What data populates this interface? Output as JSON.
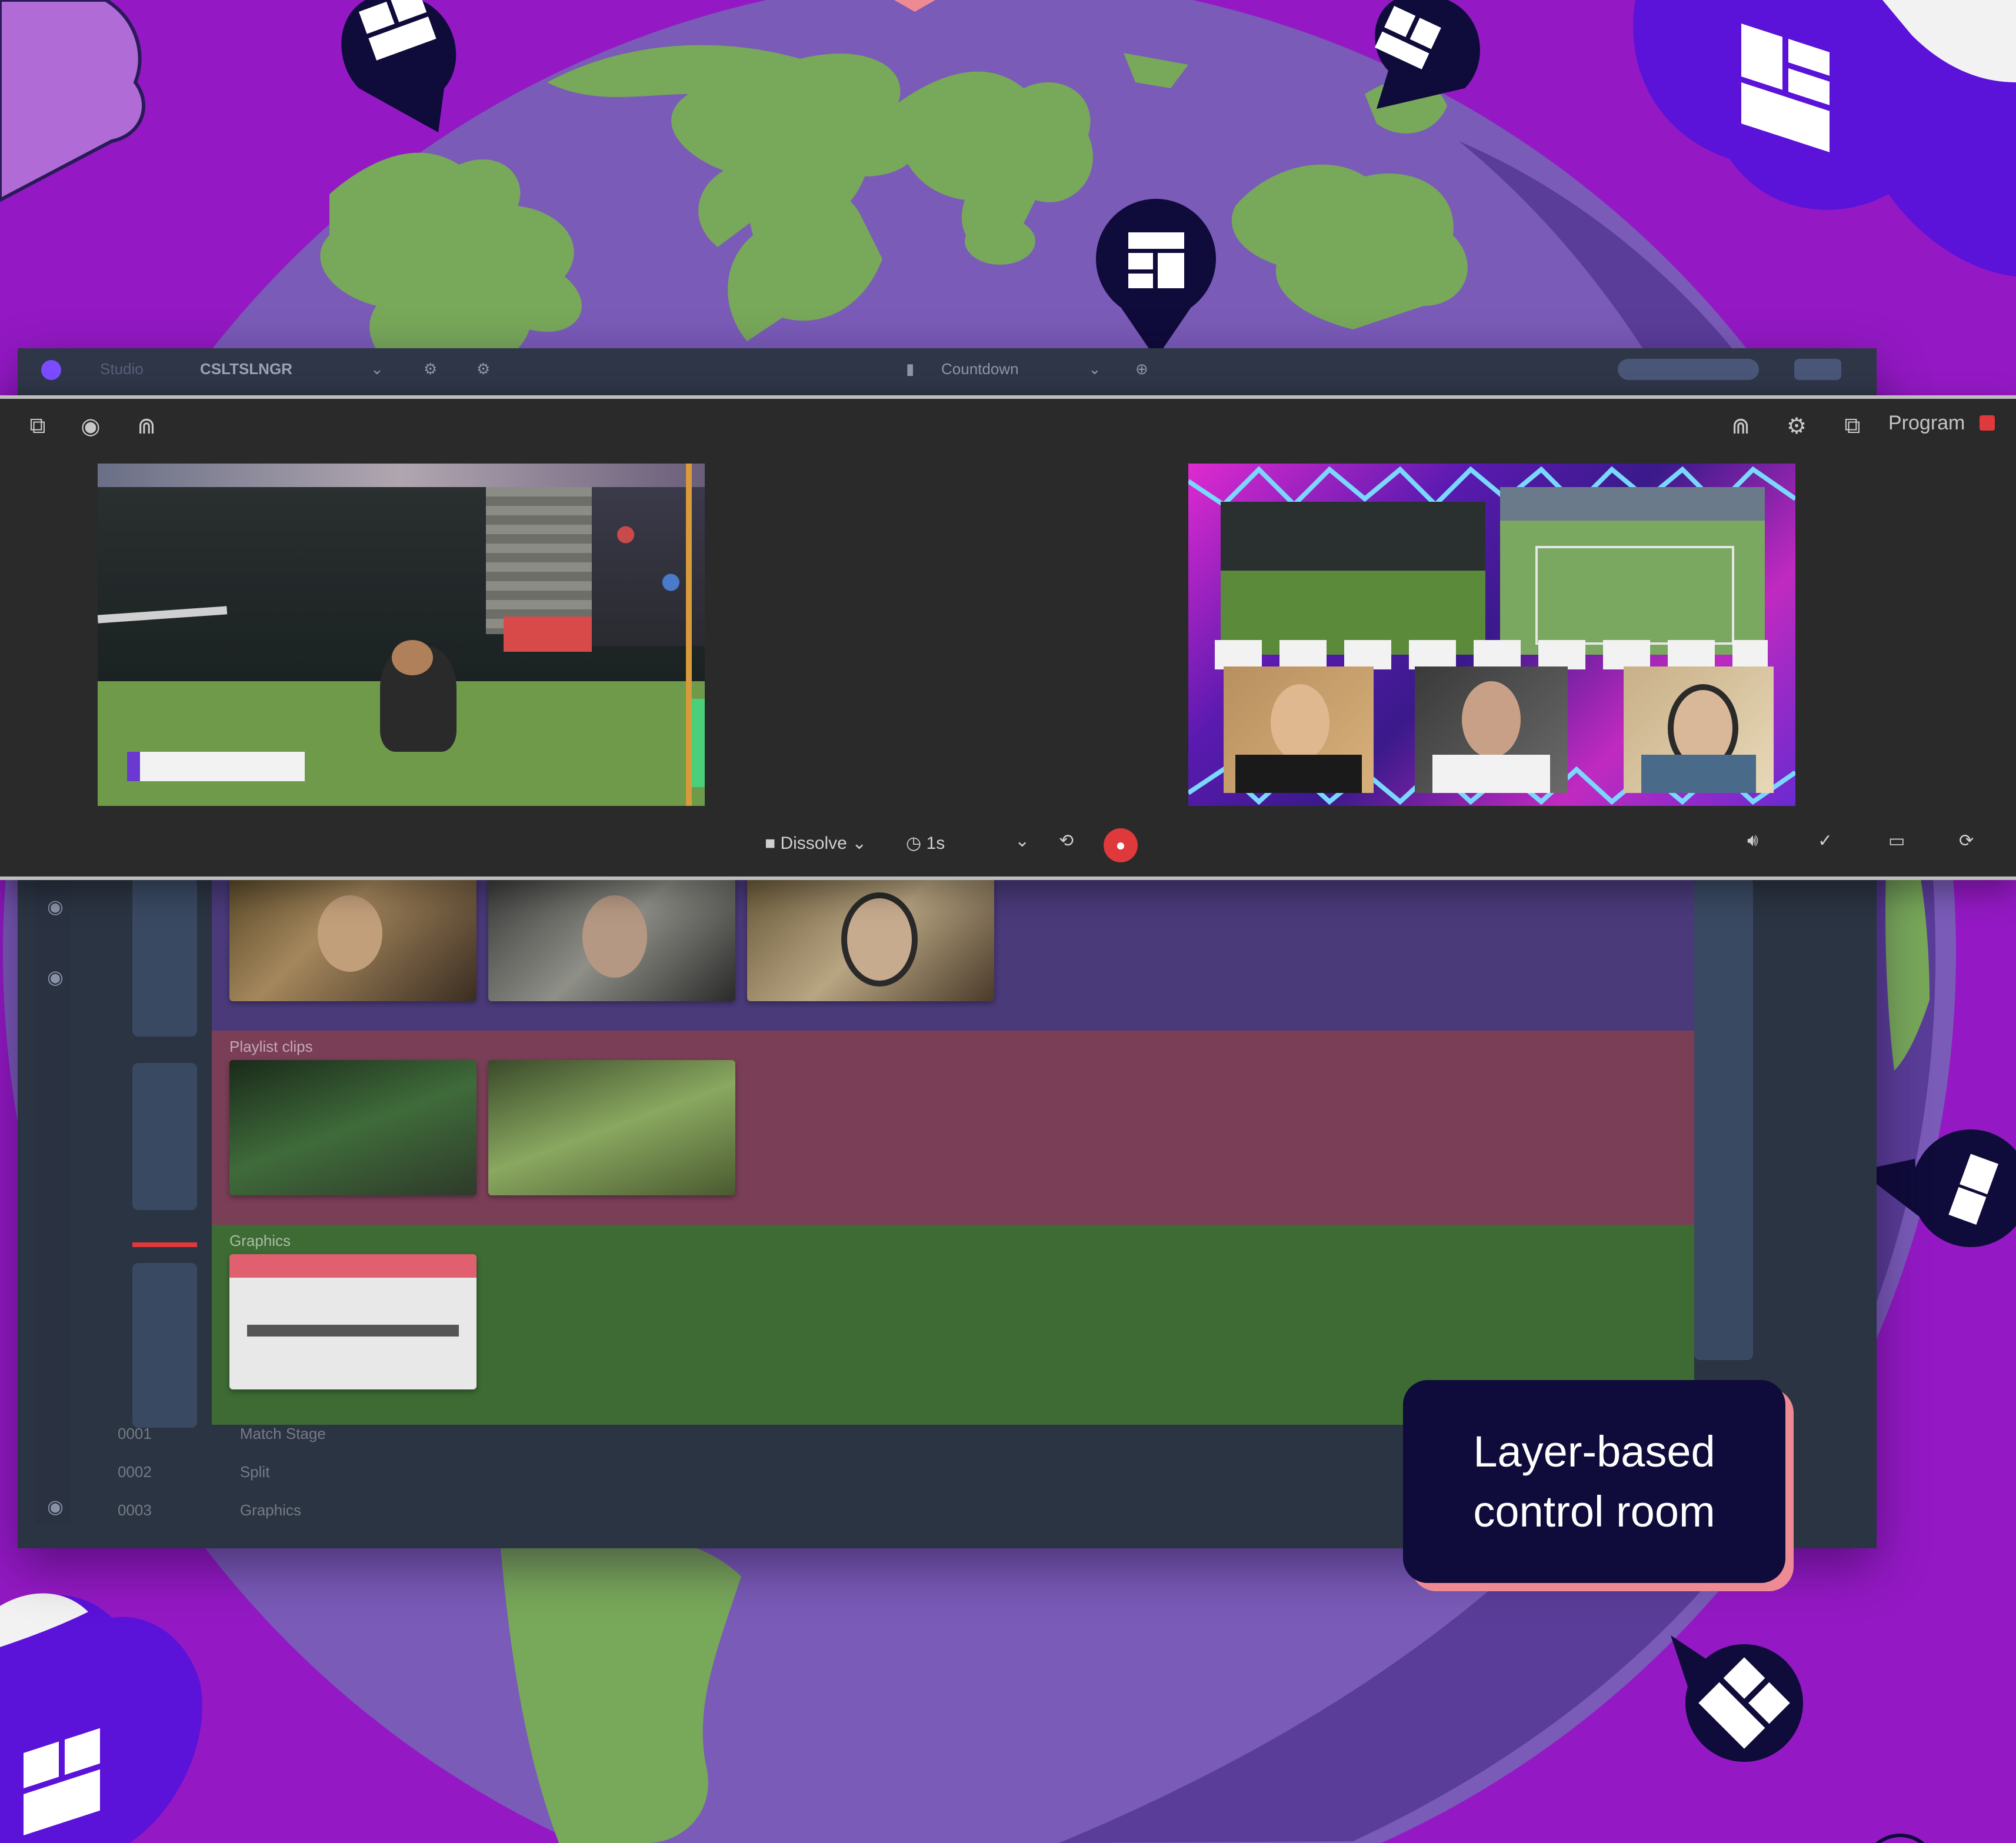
{
  "colors": {
    "background": "#9419c4",
    "globe": "#7a5bb8",
    "continents": "#78a85a",
    "pin": "#0f0b3a",
    "callout_bg": "#0f0b3a",
    "callout_shadow": "#ee8a94",
    "layer_video": "#4a3a7a",
    "layer_clips": "#7a3f57",
    "layer_graphics": "#3e6b34",
    "record": "#e0393b"
  },
  "titlebar": {
    "items": [
      "Studio",
      "CSLTSLNGR",
      "Countdown"
    ]
  },
  "monitor": {
    "program_label": "Program"
  },
  "controls": {
    "transition_label": "Dissolve",
    "duration_label": "1s"
  },
  "layers": [
    {
      "name": "",
      "thumb_count": 3
    },
    {
      "name": "Playlist clips",
      "thumb_count": 2
    },
    {
      "name": "Graphics",
      "thumb_count": 1
    }
  ],
  "list_rows": [
    {
      "id": "0001",
      "label": "Match Stage"
    },
    {
      "id": "0002",
      "label": "Split"
    },
    {
      "id": "0003",
      "label": "Graphics"
    }
  ],
  "callout": {
    "line1": "Layer-based",
    "line2": "control room"
  },
  "icons": [
    "pin-icon",
    "cloud-icon",
    "popout-icon",
    "eye-icon",
    "headphones-icon",
    "gear-icon",
    "volume-icon",
    "layout-icon",
    "refresh-icon",
    "record-icon",
    "chevron-down-icon"
  ]
}
